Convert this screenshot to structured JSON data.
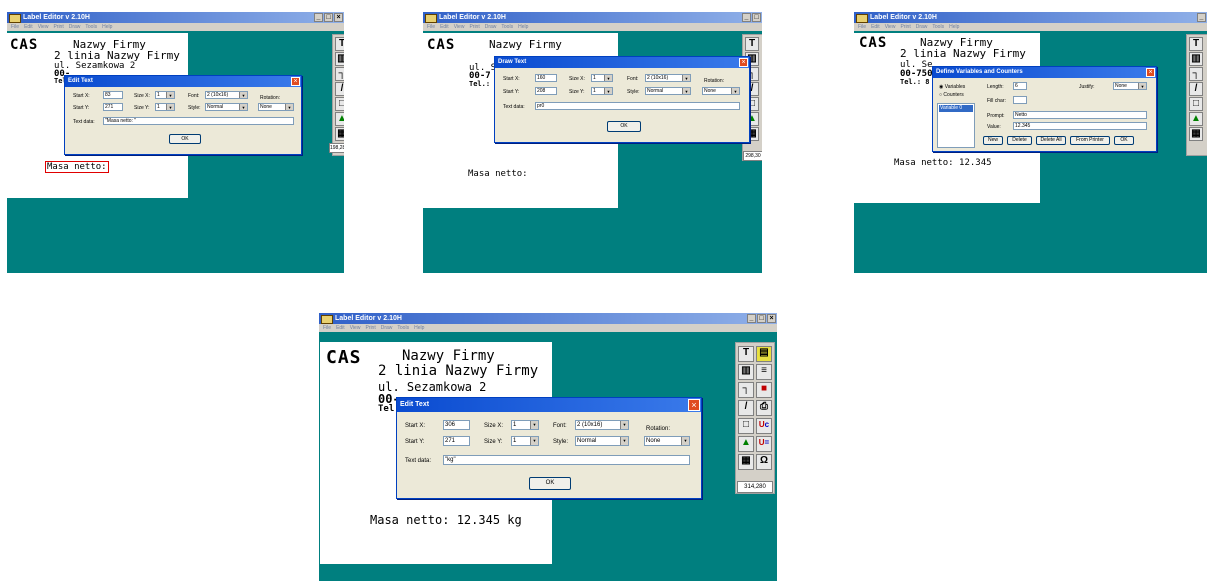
{
  "window": {
    "title": "Label Editor v 2.10H",
    "menus": [
      "File",
      "Edit",
      "View",
      "Print",
      "Draw",
      "Tools",
      "Help"
    ],
    "buttons": {
      "minimize": "_",
      "restore": "□",
      "close": "×"
    }
  },
  "label": {
    "brand": "CAS",
    "company": "Nazwy Firmy",
    "company2": "2 linia Nazwy Firmy",
    "street": "ul. Sezamkowa 2",
    "postal_partial": "00-",
    "phone_partial": "Tel",
    "postal_full_start": "00-7",
    "phone_start": "Tel.:",
    "street_partial": "ul. Se",
    "postal_partial3": "00-750",
    "phone_partial3": "Tel.: 8",
    "mass_label": "Masa netto:",
    "mass_value": "Masa netto: 12.345",
    "mass_value_kg": "Masa netto: 12.345 kg"
  },
  "toolbar": {
    "icons": [
      "text-tool-icon",
      "text-box-icon",
      "barcode-icon",
      "list-icon",
      "hammer-icon",
      "logo-icon",
      "line-icon",
      "print-icon",
      "rect-icon",
      "uc-icon",
      "image-icon",
      "u-equals-icon",
      "grid-icon",
      "magnet-icon"
    ],
    "coords1": "198,280",
    "coords2": "298,30",
    "coords4": "314,280"
  },
  "edit_text_1": {
    "title": "Edit Text",
    "start_x_label": "Start X:",
    "start_x": "83",
    "start_y_label": "Start Y:",
    "start_y": "271",
    "size_x_label": "Size X:",
    "size_x": "1",
    "size_y_label": "Size Y:",
    "size_y": "1",
    "font_label": "Font:",
    "font": "2 (10x16)",
    "style_label": "Style:",
    "style": "Normal",
    "rotation_label": "Rotation:",
    "rotation": "None",
    "text_data_label": "Text data:",
    "text_data": "\"Masa netto: \"",
    "ok": "OK"
  },
  "draw_text": {
    "title": "Draw Text",
    "start_x_label": "Start X:",
    "start_x": "160",
    "start_y_label": "Start Y:",
    "start_y": "208",
    "size_x_label": "Size X:",
    "size_x": "1",
    "size_y_label": "Size Y:",
    "size_y": "1",
    "font_label": "Font:",
    "font": "2 (10x16)",
    "style_label": "Style:",
    "style": "Normal",
    "rotation_label": "Rotation:",
    "rotation": "None",
    "text_data_label": "Text data:",
    "text_data": "pr0",
    "ok": "OK"
  },
  "define_vars": {
    "title": "Define Variables and Counters",
    "radio_variables": "Variables",
    "radio_counters": "Counters",
    "list_item": "Variable 0",
    "length_label": "Length:",
    "length": "6",
    "justify_label": "Justify:",
    "justify": "None",
    "fill_char_label": "Fill char:",
    "fill_char": "",
    "prompt_label": "Prompt:",
    "prompt": "Netto",
    "value_label": "Value:",
    "value": "12.345",
    "btn_new": "New",
    "btn_delete": "Delete",
    "btn_delete_all": "Delete All",
    "btn_from_printer": "From Printer",
    "btn_ok": "OK"
  },
  "edit_text_2": {
    "title": "Edit Text",
    "start_x_label": "Start X:",
    "start_x": "306",
    "start_y_label": "Start Y:",
    "start_y": "271",
    "size_x_label": "Size X:",
    "size_x": "1",
    "size_y_label": "Size Y:",
    "size_y": "1",
    "font_label": "Font:",
    "font": "2 (10x16)",
    "style_label": "Style:",
    "style": "Normal",
    "rotation_label": "Rotation:",
    "rotation": "None",
    "text_data_label": "Text data:",
    "text_data": "\"kg\"",
    "ok": "OK"
  },
  "colors": {
    "desktop": "#007f7f",
    "titlebar": "#3060c8",
    "dialog_title": "#0a4bd0",
    "close_red": "#e04c20",
    "mass_highlight": "#e00000"
  }
}
